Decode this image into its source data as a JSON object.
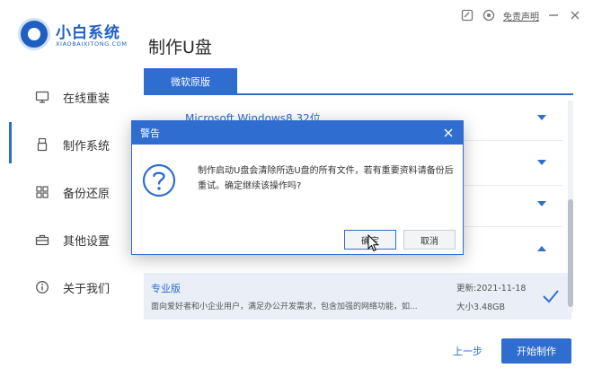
{
  "app": {
    "brand": "小白系统",
    "brand_sub": "XIAOBAIXITONG.COM",
    "page_title": "制作U盘",
    "disclaimer": "免责声明"
  },
  "sidebar": {
    "items": [
      {
        "label": "在线重装",
        "icon": "monitor-icon"
      },
      {
        "label": "制作系统",
        "icon": "usb-icon",
        "active": true
      },
      {
        "label": "备份还原",
        "icon": "grid-icon"
      },
      {
        "label": "其他设置",
        "icon": "toolbox-icon"
      },
      {
        "label": "关于我们",
        "icon": "info-icon"
      }
    ]
  },
  "list": {
    "tab_label": "微软原版",
    "first_row_label": "Microsoft Windows8 32位",
    "selected": {
      "name": "专业版",
      "description": "面向爱好者和小企业用户，满足办公开发需求，包含加强的网络功能，如...",
      "date": "更新:2021-11-18",
      "size": "大小3.48GB"
    }
  },
  "footer": {
    "prev_label": "上一步",
    "start_label": "开始制作"
  },
  "dialog": {
    "title": "警告",
    "message": "制作启动U盘会清除所选U盘的所有文件，若有重要资料请备份后重试。确定继续该操作吗?",
    "ok_label": "确定",
    "cancel_label": "取消"
  },
  "colors": {
    "accent": "#2f6ed0"
  }
}
